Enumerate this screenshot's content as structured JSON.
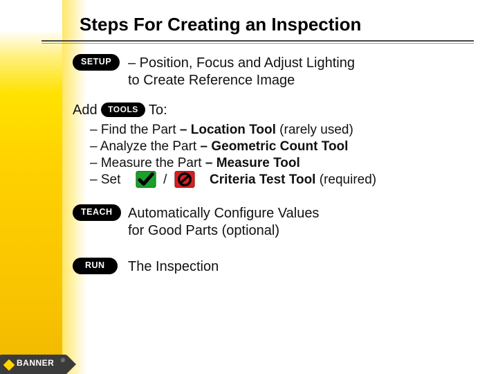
{
  "title": "Steps For Creating an Inspection",
  "step1": {
    "pill": "SETUP",
    "line1": "– Position, Focus and Adjust Lighting",
    "line2": "to Create Reference Image"
  },
  "step2": {
    "lead": "Add",
    "pill": "TOOLS",
    "tail": "To:",
    "bullets": {
      "b1_pre": "– Find the Part ",
      "b1_bold": "– Location Tool",
      "b1_post": " (rarely used)",
      "b2_pre": "– Analyze the Part ",
      "b2_bold": "– Geometric Count Tool",
      "b3_pre": "– Measure the Part ",
      "b3_bold": "– Measure Tool",
      "b4_pre": "– Set",
      "b4_slash": "/",
      "b4_tail_bold": "Criteria Test Tool",
      "b4_tail_post": " (required)"
    }
  },
  "step3": {
    "pill": "TEACH",
    "line1": "Automatically Configure Values",
    "line2": "for Good Parts (optional)"
  },
  "step4": {
    "pill": "RUN",
    "line1": "The Inspection"
  },
  "logo": {
    "text": "BANNER"
  }
}
